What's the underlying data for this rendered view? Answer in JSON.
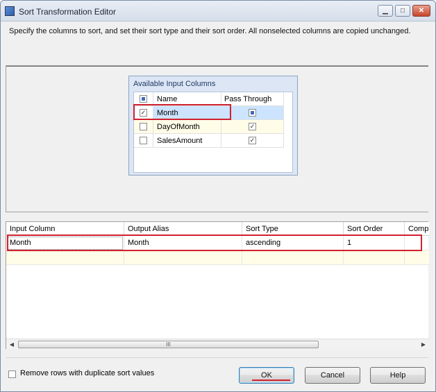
{
  "window": {
    "title": "Sort Transformation Editor",
    "min_label": "▁",
    "max_label": "□",
    "close_label": "✕"
  },
  "description": "Specify the columns to sort, and set their sort type and their sort order. All nonselected columns are copied unchanged.",
  "available_columns": {
    "title": "Available Input Columns",
    "headers": {
      "name": "Name",
      "pass_through": "Pass Through"
    },
    "rows": [
      {
        "name": "Month",
        "selected": true,
        "pass_through": "indeterminate"
      },
      {
        "name": "DayOfMonth",
        "selected": false,
        "pass_through": "checked"
      },
      {
        "name": "SalesAmount",
        "selected": false,
        "pass_through": "checked"
      }
    ]
  },
  "sort_grid": {
    "headers": {
      "input_column": "Input Column",
      "output_alias": "Output Alias",
      "sort_type": "Sort Type",
      "sort_order": "Sort Order",
      "comparison": "Compa"
    },
    "rows": [
      {
        "input_column": "Month",
        "output_alias": "Month",
        "sort_type": "ascending",
        "sort_order": "1"
      }
    ],
    "scroll_grip": "III"
  },
  "remove_duplicates_label": "Remove rows with duplicate sort values",
  "buttons": {
    "ok": "OK",
    "cancel": "Cancel",
    "help": "Help"
  },
  "colors": {
    "highlight": "#d0202e",
    "selected_row": "#cce4ff",
    "new_row": "#fffde8"
  }
}
